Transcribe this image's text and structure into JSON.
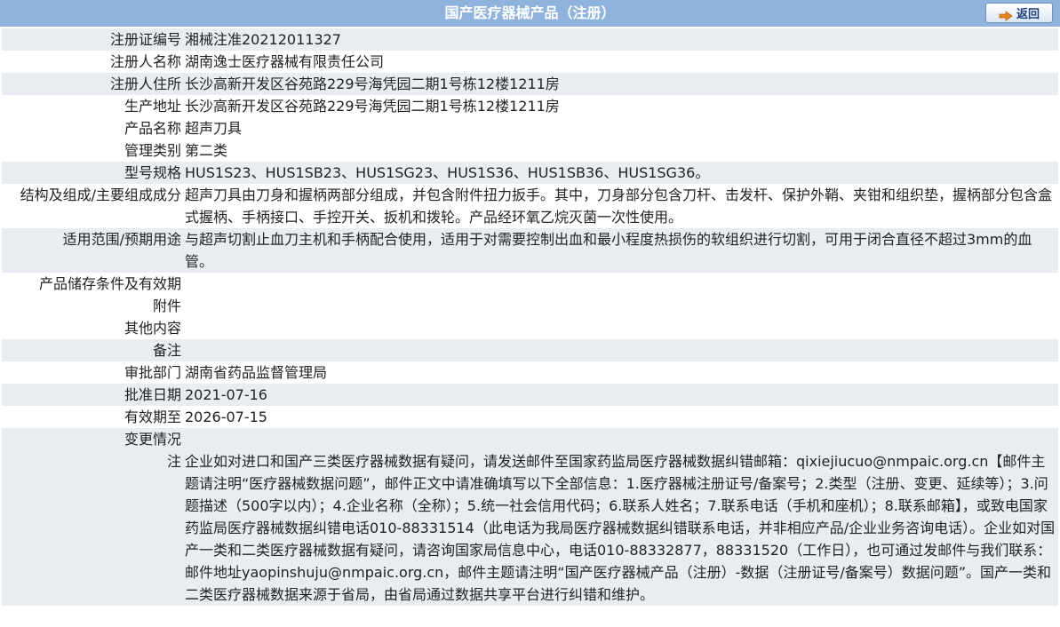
{
  "header": {
    "title": "国产医疗器械产品（注册）",
    "back_label": "返回"
  },
  "rows": [
    {
      "label": "注册证编号",
      "value": "湘械注准20212011327"
    },
    {
      "label": "注册人名称",
      "value": "湖南逸士医疗器械有限责任公司"
    },
    {
      "label": "注册人住所",
      "value": "长沙高新开发区谷苑路229号海凭园二期1号栋12楼1211房"
    },
    {
      "label": "生产地址",
      "value": "长沙高新开发区谷苑路229号海凭园二期1号栋12楼1211房"
    },
    {
      "label": "产品名称",
      "value": "超声刀具"
    },
    {
      "label": "管理类别",
      "value": "第二类"
    },
    {
      "label": "型号规格",
      "value": "HUS1S23、HUS1SB23、HUS1SG23、HUS1S36、HUS1SB36、HUS1SG36。"
    },
    {
      "label": "结构及组成/主要组成成分",
      "value": "超声刀具由刀身和握柄两部分组成，并包含附件扭力扳手。其中，刀身部分包含刀杆、击发杆、保护外鞘、夹钳和组织垫，握柄部分包含盒式握柄、手柄接口、手控开关、扳机和拨轮。产品经环氧乙烷灭菌一次性使用。"
    },
    {
      "label": "适用范围/预期用途",
      "value": "与超声切割止血刀主机和手柄配合使用，适用于对需要控制出血和最小程度热损伤的软组织进行切割，可用于闭合直径不超过3mm的血管。"
    },
    {
      "label": "产品储存条件及有效期",
      "value": ""
    },
    {
      "label": "附件",
      "value": ""
    },
    {
      "label": "其他内容",
      "value": ""
    },
    {
      "label": "备注",
      "value": ""
    },
    {
      "label": "审批部门",
      "value": "湖南省药品监督管理局"
    },
    {
      "label": "批准日期",
      "value": "2021-07-16"
    },
    {
      "label": "有效期至",
      "value": "2026-07-15"
    },
    {
      "label": "变更情况",
      "value": ""
    }
  ],
  "note": {
    "label": "注",
    "text": "企业如对进口和国产三类医疗器械数据有疑问，请发送邮件至国家药监局医疗器械数据纠错邮箱：qixiejiucuo@nmpaic.org.cn【邮件主题请注明“医疗器械数据问题”，邮件正文中请准确填写以下全部信息：1.医疗器械注册证号/备案号；2.类型（注册、变更、延续等）；3.问题描述（500字以内）；4.企业名称（全称）；5.统一社会信用代码；6.联系人姓名；7.联系电话（手机和座机）；8.联系邮箱】，或致电国家药监局医疗器械数据纠错电话010-88331514（此电话为我局医疗器械数据纠错联系电话，并非相应产品/企业业务咨询电话）。企业如对国产一类和二类医疗器械数据有疑问，请咨询国家局信息中心，电话010-88332877，88331520（工作日），也可通过发邮件与我们联系：邮件地址yaopinshuju@nmpaic.org.cn，邮件主题请注明“国产医疗器械产品（注册）-数据（注册证号/备案号）数据问题”。国产一类和二类医疗器械数据来源于省局，由省局通过数据共享平台进行纠错和维护。"
  }
}
